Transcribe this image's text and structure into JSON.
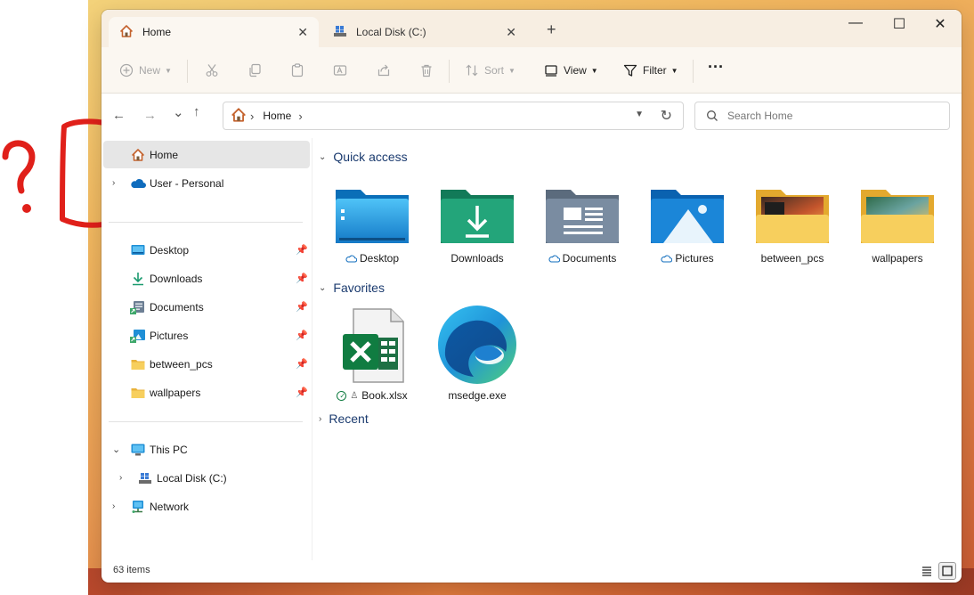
{
  "tabs": [
    {
      "label": "Home",
      "close": "✕"
    },
    {
      "label": "Local Disk (C:)",
      "close": "✕"
    }
  ],
  "new_tab": "+",
  "window_controls": {
    "minimize": "—",
    "maximize": "☐",
    "close": "✕"
  },
  "toolbar": {
    "new_label": "New",
    "sort_label": "Sort",
    "view_label": "View",
    "filter_label": "Filter",
    "more_label": "···"
  },
  "nav": {
    "back": "←",
    "forward": "→",
    "recent": "⌄",
    "up": "↑"
  },
  "address": {
    "crumbs": [
      "Home"
    ],
    "chevron": "›",
    "refresh": "↻"
  },
  "search": {
    "placeholder": "Search Home"
  },
  "annotation": {
    "symbol": "?",
    "color": "#e0201a"
  },
  "sidebar": {
    "home": "Home",
    "user": "User - Personal",
    "pinned": [
      {
        "label": "Desktop",
        "icon": "desktop-icon"
      },
      {
        "label": "Downloads",
        "icon": "download-icon"
      },
      {
        "label": "Documents",
        "icon": "documents-icon"
      },
      {
        "label": "Pictures",
        "icon": "pictures-icon"
      },
      {
        "label": "between_pcs",
        "icon": "folder-icon"
      },
      {
        "label": "wallpapers",
        "icon": "folder-icon"
      }
    ],
    "this_pc": "This PC",
    "local_disk": "Local Disk (C:)",
    "network": "Network"
  },
  "main": {
    "quick_access_header": "Quick access",
    "favorites_header": "Favorites",
    "recent_header": "Recent",
    "quick_access": [
      {
        "label": "Desktop",
        "cloud": true
      },
      {
        "label": "Downloads",
        "cloud": false
      },
      {
        "label": "Documents",
        "cloud": true
      },
      {
        "label": "Pictures",
        "cloud": true
      },
      {
        "label": "between_pcs",
        "cloud": false
      },
      {
        "label": "wallpapers",
        "cloud": false
      }
    ],
    "favorites": [
      {
        "label": "Book.xlsx"
      },
      {
        "label": "msedge.exe"
      }
    ]
  },
  "status": {
    "item_count": "63 items"
  },
  "colors": {
    "accent": "#0067c0",
    "header": "#1b3b6f",
    "folder_yellow": "#f7c948",
    "excel": "#1d7044"
  }
}
